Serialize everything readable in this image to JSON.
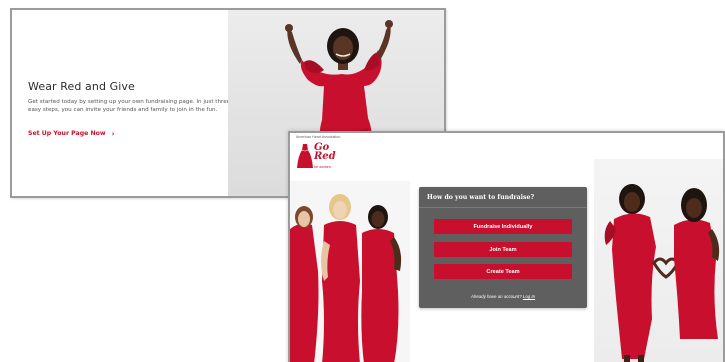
{
  "back_card": {
    "heading": "Wear Red and Give",
    "body": "Get started today by setting up your own fundraising page. In just three easy steps, you can invite your friends and family to join in the fun.",
    "cta_label": "Set Up Your Page Now",
    "cta_chevron": "›"
  },
  "front_card": {
    "association_label": "American Heart Association.",
    "logo": {
      "line1": "Go",
      "line2": "Red",
      "tagline": "for women."
    },
    "panel": {
      "title": "How do you want to fundraise?",
      "buttons": [
        {
          "label": "Fundraise Individually"
        },
        {
          "label": "Join Team"
        },
        {
          "label": "Create Team"
        }
      ],
      "footer_prefix": "Already have an account?",
      "login_label": "Log In"
    }
  },
  "colors": {
    "brand_red": "#c8102e",
    "panel_gray": "#5f5f5f",
    "frame_border": "#9b9b9b"
  },
  "icons": {
    "cta": "chevron-right-icon",
    "logo": "red-dress-icon"
  }
}
